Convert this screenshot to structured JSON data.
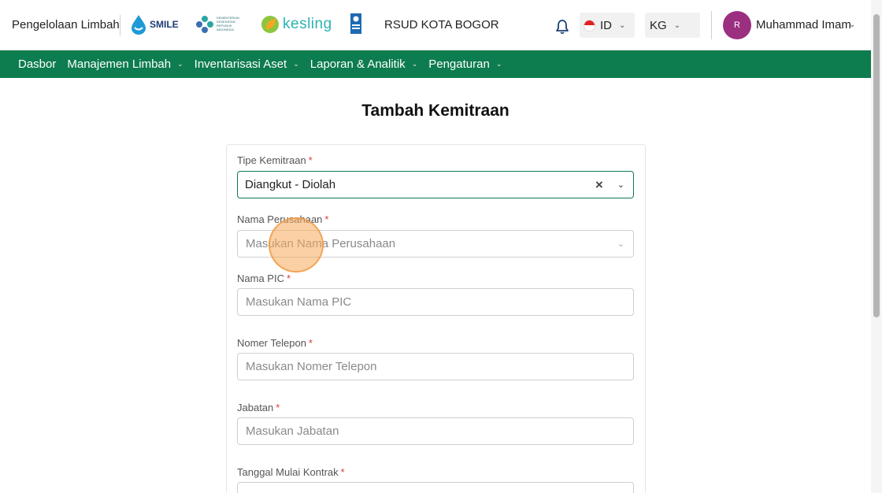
{
  "header": {
    "brand": "Pengelolaan Limbah",
    "logos": {
      "smile": "SMILE",
      "kemkes": "Kementerian Kesehatan Republik Indonesia",
      "kesling": "kesling"
    },
    "hospital": "RSUD KOTA BOGOR",
    "language": "ID",
    "unit": "KG",
    "user_initial": "R",
    "user_name": "Muhammad Imam"
  },
  "nav": {
    "items": [
      {
        "label": "Dasbor",
        "has_dropdown": false
      },
      {
        "label": "Manajemen Limbah",
        "has_dropdown": true
      },
      {
        "label": "Inventarisasi Aset",
        "has_dropdown": true
      },
      {
        "label": "Laporan & Analitik",
        "has_dropdown": true
      },
      {
        "label": "Pengaturan",
        "has_dropdown": true
      }
    ]
  },
  "page": {
    "title": "Tambah Kemitraan"
  },
  "form": {
    "tipe_kemitraan": {
      "label": "Tipe Kemitraan",
      "value": "Diangkut - Diolah"
    },
    "nama_perusahaan": {
      "label": "Nama Perusahaan",
      "placeholder": "Masukan Nama Perusahaan"
    },
    "nama_pic": {
      "label": "Nama PIC",
      "placeholder": "Masukan Nama PIC"
    },
    "nomer_telepon": {
      "label": "Nomer Telepon",
      "placeholder": "Masukan Nomer Telepon"
    },
    "jabatan": {
      "label": "Jabatan",
      "placeholder": "Masukan Jabatan"
    },
    "tanggal_mulai": {
      "label": "Tanggal Mulai Kontrak"
    },
    "required_mark": "*"
  },
  "colors": {
    "primary": "#0d7c4e",
    "avatar": "#9b2f80",
    "required": "#e03a3a"
  }
}
